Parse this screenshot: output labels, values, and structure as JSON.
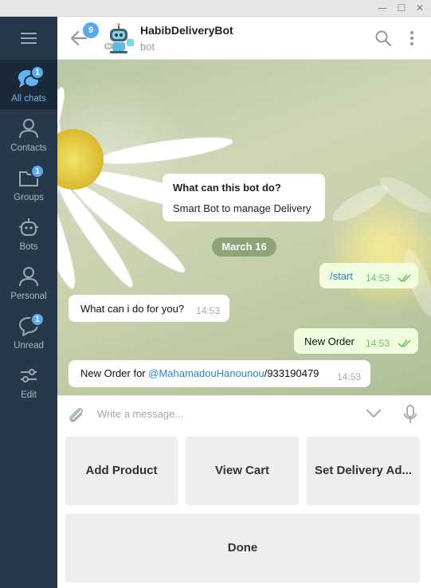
{
  "window": {
    "minimize_icon": "minimize-icon",
    "maximize_icon": "maximize-icon",
    "close_icon": "close-icon"
  },
  "sidebar": {
    "menu_icon": "hamburger-icon",
    "folders": [
      {
        "label": "All chats",
        "icon": "chats-icon",
        "badge": "1",
        "active": true
      },
      {
        "label": "Contacts",
        "icon": "person-icon",
        "badge": "",
        "active": false
      },
      {
        "label": "Groups",
        "icon": "folder-icon",
        "badge": "1",
        "active": false
      },
      {
        "label": "Bots",
        "icon": "bot-icon",
        "badge": "",
        "active": false
      },
      {
        "label": "Personal",
        "icon": "person-icon",
        "badge": "",
        "active": false
      },
      {
        "label": "Unread",
        "icon": "chat-bubble-icon",
        "badge": "1",
        "active": false
      },
      {
        "label": "Edit",
        "icon": "sliders-icon",
        "badge": "",
        "active": false
      }
    ]
  },
  "header": {
    "back_badge": "9",
    "title": "HabibDeliveryBot",
    "subtitle": "bot"
  },
  "chat": {
    "bot_info": {
      "title": "What can this bot do?",
      "text": "Smart Bot to manage Delivery"
    },
    "date": "March 16",
    "messages": [
      {
        "dir": "out",
        "text": "/start",
        "time": "14:53"
      },
      {
        "dir": "in",
        "text": "What can i do for you?",
        "time": "14:53"
      },
      {
        "dir": "out",
        "text": "New Order",
        "time": "14:53"
      },
      {
        "dir": "in",
        "prefix": "New Order for ",
        "mention": "@MahamadouHanounou",
        "suffix": "/933190479",
        "time": "14:53"
      }
    ]
  },
  "composer": {
    "placeholder": "Write a message..."
  },
  "keyboard": {
    "buttons": [
      "Add Product",
      "View Cart",
      "Set Delivery Ad...",
      "Done"
    ]
  },
  "colors": {
    "sidebar_bg": "#26384a",
    "accent": "#57aaf0",
    "outgoing_bubble": "#effdde",
    "read_check": "#6cc264"
  }
}
